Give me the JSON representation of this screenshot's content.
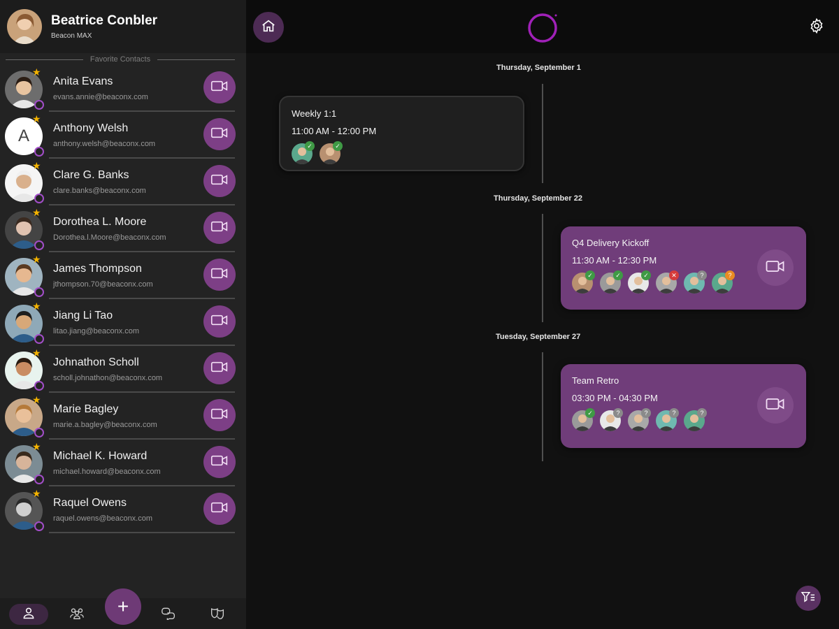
{
  "profile": {
    "name": "Beatrice Conbler",
    "subtitle": "Beacon MAX"
  },
  "favorites": {
    "section_title": "Favorite Contacts",
    "contacts": [
      {
        "name": "Anita Evans",
        "email": "evans.annie@beaconx.com"
      },
      {
        "name": "Anthony Welsh",
        "email": "anthony.welsh@beaconx.com",
        "initial": "A"
      },
      {
        "name": "Clare G. Banks",
        "email": "clare.banks@beaconx.com"
      },
      {
        "name": "Dorothea L. Moore",
        "email": "Dorothea.l.Moore@beaconx.com"
      },
      {
        "name": "James Thompson",
        "email": "jthompson.70@beaconx.com"
      },
      {
        "name": "Jiang Li Tao",
        "email": "litao.jiang@beaconx.com"
      },
      {
        "name": "Johnathon Scholl",
        "email": "scholl.johnathon@beaconx.com"
      },
      {
        "name": "Marie Bagley",
        "email": "marie.a.bagley@beaconx.com"
      },
      {
        "name": "Michael K. Howard",
        "email": "michael.howard@beaconx.com"
      },
      {
        "name": "Raquel Owens",
        "email": "raquel.owens@beaconx.com"
      }
    ]
  },
  "bottom_nav": {
    "add_symbol": "+"
  },
  "timeline": {
    "dates": [
      "Thursday, September 1",
      "Thursday, September 22",
      "Tuesday, September 27"
    ],
    "events": [
      {
        "title": "Weekly 1:1",
        "time": "11:00 AM - 12:00 PM",
        "attendee_statuses": [
          "accepted",
          "accepted"
        ]
      },
      {
        "title": "Q4 Delivery Kickoff",
        "time": "11:30 AM - 12:30 PM",
        "attendee_statuses": [
          "accepted",
          "accepted",
          "accepted",
          "declined",
          "pending",
          "tentative"
        ]
      },
      {
        "title": "Team Retro",
        "time": "03:30 PM - 04:30 PM",
        "attendee_statuses": [
          "accepted",
          "pending",
          "pending",
          "pending",
          "pending"
        ]
      }
    ]
  },
  "colors": {
    "accent": "#7d3f86",
    "accent_dark": "#4d2b54",
    "logo_ring": "#a021b8",
    "star": "#f5b400",
    "background": "#111111"
  },
  "icons": {
    "video": "video-camera-icon",
    "home": "home-icon",
    "settings": "gear-icon",
    "filter": "filter-icon",
    "nav": [
      "person-icon",
      "group-icon",
      "chat-icon",
      "mask-icon"
    ]
  }
}
